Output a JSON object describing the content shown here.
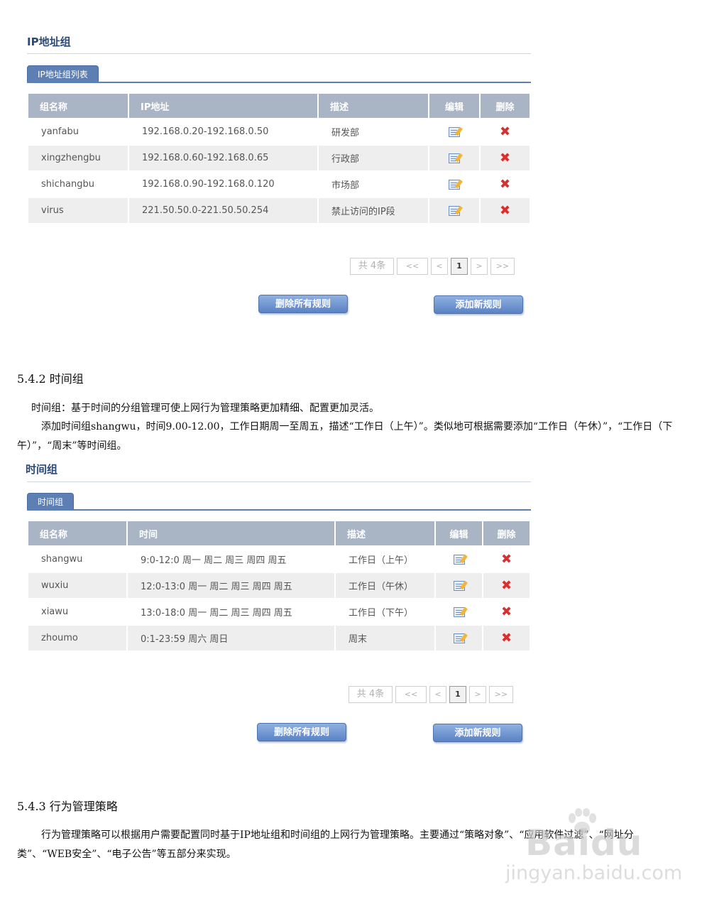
{
  "ip_section": {
    "title": "IP地址组",
    "tab": "IP地址组列表",
    "columns": [
      "组名称",
      "IP地址",
      "描述",
      "编辑",
      "删除"
    ],
    "rows": [
      {
        "name": "yanfabu",
        "value": "192.168.0.20-192.168.0.50",
        "desc": "研发部"
      },
      {
        "name": "xingzhengbu",
        "value": "192.168.0.60-192.168.0.65",
        "desc": "行政部"
      },
      {
        "name": "shichangbu",
        "value": "192.168.0.90-192.168.0.120",
        "desc": "市场部"
      },
      {
        "name": "virus",
        "value": "221.50.50.0-221.50.50.254",
        "desc": "禁止访问的IP段"
      }
    ],
    "pager": {
      "total": "共 4条",
      "first": "<<",
      "prev": "<",
      "current": "1",
      "next": ">",
      "last": ">>"
    },
    "delete_all": "删除所有规则",
    "add_new": "添加新规则"
  },
  "section_542": {
    "heading": "5.4.2 时间组",
    "p1": "时间组：基于时间的分组管理可使上网行为管理策略更加精细、配置更加灵活。",
    "p2": "添加时间组shangwu，时间9.00-12.00，工作日期周一至周五，描述“工作日（上午）”。类似地可根据需要添加“工作日（午休）”，“工作日（下午）”，“周末”等时间组。"
  },
  "time_section": {
    "title": "时间组",
    "tab": "时间组",
    "columns": [
      "组名称",
      "时间",
      "描述",
      "编辑",
      "删除"
    ],
    "rows": [
      {
        "name": "shangwu",
        "value": "9:0-12:0 周一  周二  周三  周四  周五",
        "desc": "工作日（上午）"
      },
      {
        "name": "wuxiu",
        "value": "12:0-13:0 周一  周二  周三  周四  周五",
        "desc": "工作日（午休）"
      },
      {
        "name": "xiawu",
        "value": "13:0-18:0 周一  周二  周三  周四  周五",
        "desc": "工作日（下午）"
      },
      {
        "name": "zhoumo",
        "value": "0:1-23:59 周六  周日",
        "desc": "周末"
      }
    ],
    "pager": {
      "total": "共 4条",
      "first": "<<",
      "prev": "<",
      "current": "1",
      "next": ">",
      "last": ">>"
    },
    "delete_all": "删除所有规则",
    "add_new": "添加新规则"
  },
  "section_543": {
    "heading": "5.4.3 行为管理策略",
    "p1": "行为管理策略可以根据用户需要配置同时基于IP地址组和时间组的上网行为管理策略。主要通过“策略对象”、“应用软件过滤”、“网址分类”、“WEB安全”、“电子公告”等五部分来实现。"
  },
  "watermark": {
    "brand": "Baidu",
    "url": "jingyan.baidu.com"
  },
  "icons": {
    "edit": "edit-icon",
    "delete": "delete-icon"
  },
  "colors": {
    "header_bg": "#a9b4c5",
    "tab_bg": "#5d7fb3",
    "delete": "#d63030",
    "button": "#5b82c4"
  }
}
